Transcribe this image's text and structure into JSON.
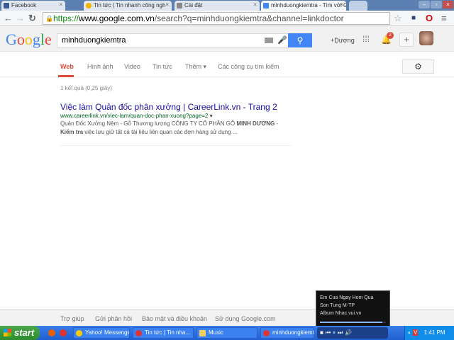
{
  "browser": {
    "tabs": [
      {
        "label": "Facebook",
        "color": "#3b5998"
      },
      {
        "label": "Tin tức | Tin nhanh công ngh",
        "color": "#f2b400"
      },
      {
        "label": "Cài đặt",
        "color": "#888888"
      },
      {
        "label": "minhduongkiemtra - Tìm với G",
        "color": "#4285f4"
      }
    ],
    "url_scheme": "https://",
    "url_domain": "www.google.com.vn",
    "url_path": "/search?q=minhduongkiemtra&channel=linkdoctor"
  },
  "google": {
    "logo": "Google",
    "query": "minhduongkiemtra",
    "user": "+Dương",
    "notifications": "2",
    "nav": [
      "Web",
      "Hình ảnh",
      "Video",
      "Tin tức",
      "Thêm ▾",
      "Các công cụ tìm kiếm"
    ],
    "stats": "1 kết quả (0,25 giây)",
    "result": {
      "title": "Việc làm Quản đốc phân xưởng | CareerLink.vn - Trang 2",
      "url": "www.careerlink.vn/viec-lam/quan-doc-phan-xuong?page=2",
      "snippet_1": "Quản Đốc Xưởng Nệm - Gỗ Thương lượng CÔNG TY CỔ PHẦN GỖ ",
      "bold_1": "MINH DƯƠNG",
      "snippet_2": " -",
      "bold_2": "Kiểm tra",
      "snippet_3": " việc lưu giữ tất cả tài liệu liên quan các đơn hàng sử dụng ..."
    },
    "footer": [
      "Trợ giúp",
      "Gửi phản hồi",
      "Bảo mật và điều khoản",
      "Sử dụng Google.com"
    ]
  },
  "media": {
    "song": "Em Cua Ngay Hom Qua",
    "artist": "Son Tung M-TP",
    "album": "Album Nhac.vui.vn",
    "progress": 0.95
  },
  "taskbar": {
    "start": "start",
    "items": [
      "Yahoo! Messenger",
      "Tin tức | Tin nha...",
      "Music",
      "minhduongkiemtr..."
    ],
    "clock": "1:41 PM"
  }
}
